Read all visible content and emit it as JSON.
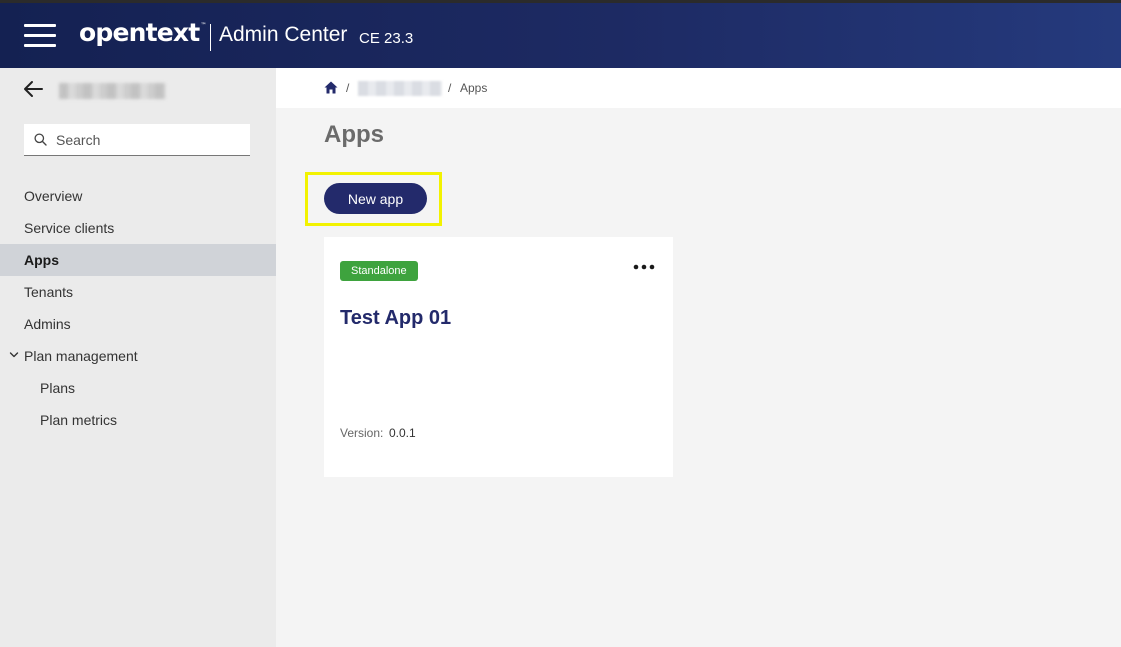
{
  "header": {
    "brand": "opentext",
    "trademark": "™",
    "app_title": "Admin Center",
    "version": "CE 23.3"
  },
  "sidebar": {
    "search_placeholder": "Search",
    "items": [
      {
        "label": "Overview"
      },
      {
        "label": "Service clients"
      },
      {
        "label": "Apps",
        "active": true
      },
      {
        "label": "Tenants"
      },
      {
        "label": "Admins"
      },
      {
        "label": "Plan management",
        "expanded": true
      },
      {
        "label": "Plans",
        "sub": true
      },
      {
        "label": "Plan metrics",
        "sub": true
      }
    ]
  },
  "breadcrumb": {
    "separator": "/",
    "current": "Apps"
  },
  "main": {
    "title": "Apps",
    "new_button": "New app",
    "cards": [
      {
        "badge": "Standalone",
        "title": "Test App 01",
        "version_label": "Version:",
        "version_value": "0.0.1"
      }
    ]
  },
  "colors": {
    "header_bg": "#1d2a63",
    "primary_button": "#232a6b",
    "badge_green": "#3ea33e",
    "highlight": "#f2f200",
    "active_nav_bg": "#d0d3d8"
  }
}
